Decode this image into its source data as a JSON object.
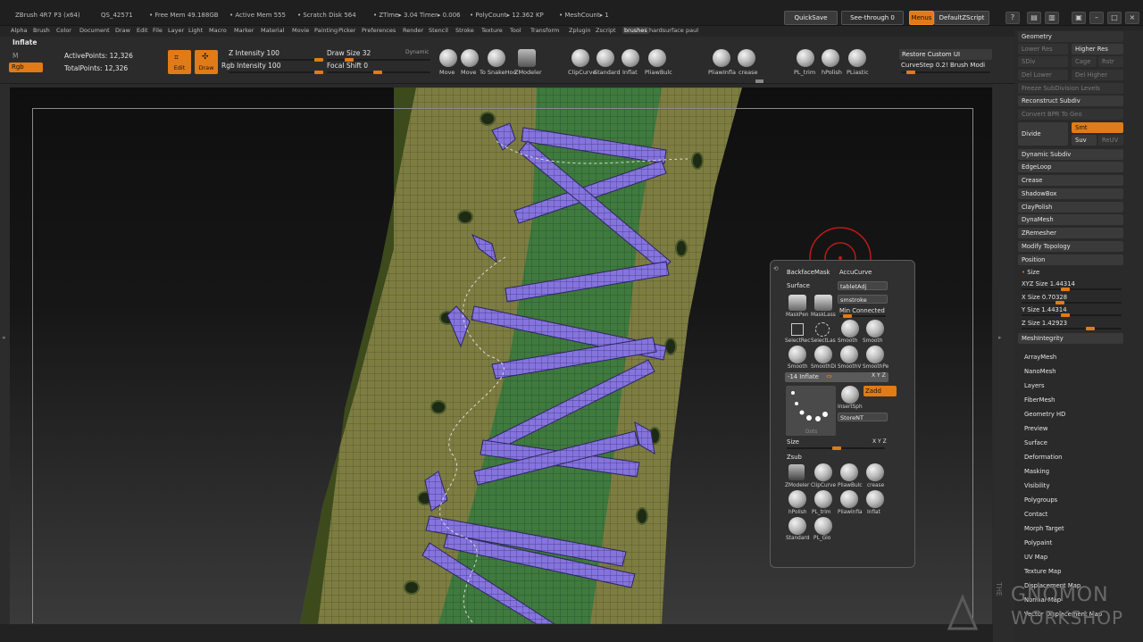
{
  "titlebar": {
    "app": "ZBrush 4R7 P3 (x64)",
    "build": "QS_42571",
    "free_mem": "• Free Mem 49.188GB",
    "active_mem": "• Active Mem 555",
    "scratch": "• Scratch Disk 564",
    "ztime": "• ZTime▸ 3.04 Timer▸ 0.006",
    "polycount": "• PolyCount▸ 12.362 KP",
    "meshcount": "• MeshCount▸ 1",
    "quicksave": "QuickSave",
    "seethrough": "See-through  0",
    "menus": "Menus",
    "script": "DefaultZScript"
  },
  "menubar": [
    "Alpha",
    "Brush",
    "Color",
    "Document",
    "Draw",
    "Edit",
    "File",
    "Layer",
    "Light",
    "Macro",
    "Marker",
    "Material",
    "Movie",
    "Painting",
    "Picker",
    "Preferences",
    "Render",
    "Stencil",
    "Stroke",
    "Texture",
    "Tool",
    "Transform",
    "Zplugin",
    "Zscript",
    "brushes",
    "hardsurface",
    "paul"
  ],
  "shelf": {
    "brush_name": "Inflate",
    "m": "M",
    "rgb": "Rgb",
    "active_points": "ActivePoints: 12,326",
    "total_points": "TotalPoints: 12,326",
    "edit": "Edit",
    "draw": "Draw",
    "z_intensity": "Z Intensity 100",
    "rgb_intensity": "Rgb Intensity 100",
    "draw_size": "Draw Size 32",
    "dynamic": "Dynamic",
    "focal_shift": "Focal Shift 0",
    "brushes": [
      "Move",
      "Move",
      "To SnakeHoo",
      "ZModeler",
      "ClipCurve",
      "Standard",
      "Inflat",
      "PliawBulc",
      "PliawInfla",
      "crease",
      "PL_trim",
      "hPolish",
      "PLiastic"
    ],
    "restore": "Restore Custom UI",
    "curvestep": "CurveStep 0.2! Brush Modi"
  },
  "right_panel": {
    "header": "Geometry",
    "lower_res": "Lower Res",
    "higher_res": "Higher Res",
    "sdiv": "SDiv",
    "cage": "Cage",
    "rstr": "Rstr",
    "del_lower": "Del Lower",
    "del_higher": "Del Higher",
    "freeze": "Freeze SubDivision Levels",
    "reconstruct": "Reconstruct Subdiv",
    "convert": "Convert BPR To Geo",
    "divide": "Divide",
    "smt": "Smt",
    "suv": "Suv",
    "reuv": "ReUV",
    "items": [
      "Dynamic Subdiv",
      "EdgeLoop",
      "Crease",
      "ShadowBox",
      "ClayPolish",
      "DynaMesh",
      "ZRemesher",
      "Modify Topology",
      "Position"
    ],
    "size": "Size",
    "xyz_size": "XYZ Size 1.44314",
    "x_size": "X Size 0.70328",
    "y_size": "Y Size 1.44314",
    "z_size": "Z Size 1.42923",
    "mesh_integrity": "MeshIntegrity",
    "subpalettes": [
      "ArrayMesh",
      "NanoMesh",
      "Layers",
      "FiberMesh",
      "Geometry HD",
      "Preview",
      "Surface",
      "Deformation",
      "Masking",
      "Visibility",
      "Polygroups",
      "Contact",
      "Morph Target",
      "Polypaint",
      "UV Map",
      "Texture Map",
      "Displacement Map",
      "Normal Map",
      "Vector Displacement Map"
    ]
  },
  "popup": {
    "backface": "BackfaceMask",
    "accucurve": "AccuCurve",
    "surface": "Surface",
    "tabletadj": "tabletAdj",
    "smstroke": "smstroke",
    "min_connected": "Min Connected",
    "row1": [
      "MaskPen",
      "MaskLass"
    ],
    "row2": [
      "SelectRec",
      "SelectLas",
      "Smooth",
      "Smooth"
    ],
    "row3": [
      "Smooth",
      "SmoothDi",
      "SmoothV",
      "SmoothPe"
    ],
    "inflate_bar": "-14 Inflate",
    "xyz": "X Y Z",
    "zadd": "Zadd",
    "insertsph": "InsertSph",
    "storent": "StoreNT",
    "dots": "Dots",
    "size": "Size",
    "zsub": "Zsub",
    "row4": [
      "ZModeler",
      "ClipCurve",
      "PliawBulc",
      "crease"
    ],
    "row5": [
      "hPolish",
      "PL_trim",
      "PliawInfla",
      "Inflat"
    ],
    "row6": [
      "Standard",
      "PL_Glo"
    ]
  },
  "logo": {
    "line1": "THE",
    "line2": "GNOMON",
    "line3": "WORKSHOP"
  },
  "colors": {
    "accent": "#e07b18",
    "mesh_green": "#7d7d42",
    "lace_purple": "#8a7be0"
  }
}
